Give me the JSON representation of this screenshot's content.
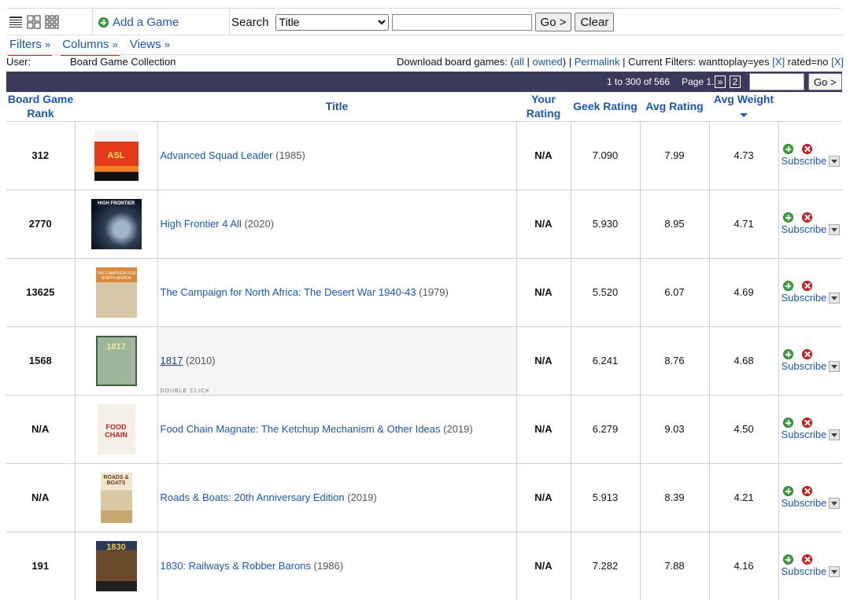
{
  "toolbar": {
    "view_icons": [
      "list-view-icon",
      "grid-view-icon",
      "compact-grid-view-icon"
    ],
    "add_game": "Add a Game",
    "search_label": "Search",
    "search_type": "Title",
    "go_label": "Go >",
    "clear_label": "Clear"
  },
  "subtabs": [
    {
      "label": "Filters",
      "suffix": "»"
    },
    {
      "label": "Columns",
      "suffix": "»"
    },
    {
      "label": "Views",
      "suffix": "»"
    }
  ],
  "info": {
    "user_label": "User:",
    "collection_title": "Board Game Collection",
    "download_label": "Download board games: (",
    "all": "all",
    "sep": " | ",
    "owned": "owned",
    "close_sep": ") | ",
    "permalink": "Permalink",
    "filters_prefix": " | Current Filters: wanttoplay=yes ",
    "x1": "[X]",
    "filters_mid": " rated=no ",
    "x2": "[X]"
  },
  "paging": {
    "range": "1 to 300 of 566",
    "page_label": "Page 1.",
    "next": "»",
    "page2": "2",
    "go_label": "Go >"
  },
  "columns": {
    "rank": "Board Game Rank",
    "title": "Title",
    "your_rating": "Your Rating",
    "geek_rating": "Geek Rating",
    "avg_rating": "Avg Rating",
    "avg_weight": "Avg Weight"
  },
  "action_label": "Subscribe",
  "double_click_hint": "DOUBLE CLICK",
  "rows": [
    {
      "rank": "312",
      "title": "Advanced Squad Leader",
      "year": "(1985)",
      "your_rating": "N/A",
      "geek": "7.090",
      "avg": "7.99",
      "weight": "4.73",
      "thumb_text": "ASL"
    },
    {
      "rank": "2770",
      "title": "High Frontier 4 All",
      "year": "(2020)",
      "your_rating": "N/A",
      "geek": "5.930",
      "avg": "8.95",
      "weight": "4.71",
      "thumb_text": "HIGH FRONTIER"
    },
    {
      "rank": "13625",
      "title": "The Campaign for North Africa: The Desert War 1940-43",
      "year": "(1979)",
      "your_rating": "N/A",
      "geek": "5.520",
      "avg": "6.07",
      "weight": "4.69",
      "thumb_text": "THE CAMPAIGN FOR NORTH AFRICA"
    },
    {
      "rank": "1568",
      "title": "1817",
      "year": "(2010)",
      "your_rating": "N/A",
      "geek": "6.241",
      "avg": "8.76",
      "weight": "4.68",
      "thumb_text": "1817"
    },
    {
      "rank": "N/A",
      "title": "Food Chain Magnate: The Ketchup Mechanism & Other Ideas",
      "year": "(2019)",
      "your_rating": "N/A",
      "geek": "6.279",
      "avg": "9.03",
      "weight": "4.50",
      "thumb_text": "FOOD CHAIN"
    },
    {
      "rank": "N/A",
      "title": "Roads & Boats: 20th Anniversary Edition",
      "year": "(2019)",
      "your_rating": "N/A",
      "geek": "5.913",
      "avg": "8.39",
      "weight": "4.21",
      "thumb_text": "ROADS & BOATS"
    },
    {
      "rank": "191",
      "title": "1830: Railways & Robber Barons",
      "year": "(1986)",
      "your_rating": "N/A",
      "geek": "7.282",
      "avg": "7.88",
      "weight": "4.16",
      "thumb_text": "1830"
    }
  ]
}
